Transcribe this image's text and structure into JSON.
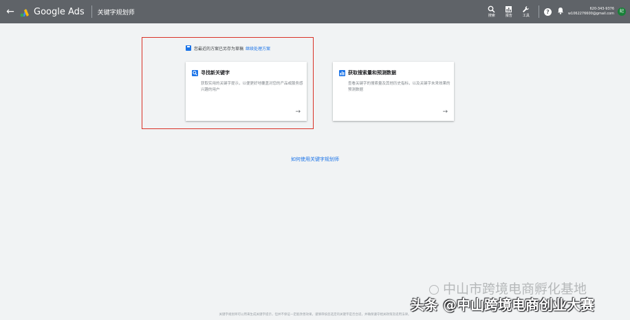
{
  "header": {
    "brand": "Google Ads",
    "page_title": "关键字规划师",
    "tools": [
      {
        "icon": "search-icon",
        "label": "搜索"
      },
      {
        "icon": "reports-icon",
        "label": "报告"
      },
      {
        "icon": "wrench-icon",
        "label": "工具"
      }
    ],
    "account_id": "620-343-9376",
    "account_email": "w1062276600@gmail.com",
    "avatar_letter": "纪"
  },
  "main": {
    "draft_text": "您最近的方案已另存为草稿",
    "draft_link": "继续处理方案",
    "cards": [
      {
        "icon": "search-icon",
        "title": "寻找新关键字",
        "desc": "获取实用的关键字提示，以便更好地覆盖对您的产品或服务感兴趣的用户"
      },
      {
        "icon": "chart-icon",
        "title": "获取搜索量和预测数据",
        "desc": "查看关键字的搜索量及其他历史指标，以及关键字未来效果的预测数据"
      }
    ],
    "howto_link": "如何使用关键字规划师"
  },
  "footer": {
    "text": "关键字规划师可以用来生成关键字提示，但并不保证一定能改善效果。谨慎审核您选定的关键字是否合适，并确保遵守相关政策及适用法律。"
  },
  "watermark": {
    "upper": "中山市跨境电商孵化基地",
    "lower": "头条 @中山跨境电商创业大赛"
  },
  "colors": {
    "header_bg": "#5f6368",
    "page_bg": "#f1f3f4",
    "accent": "#1a73e8",
    "highlight_border": "#d93025",
    "avatar_bg": "#188038"
  }
}
